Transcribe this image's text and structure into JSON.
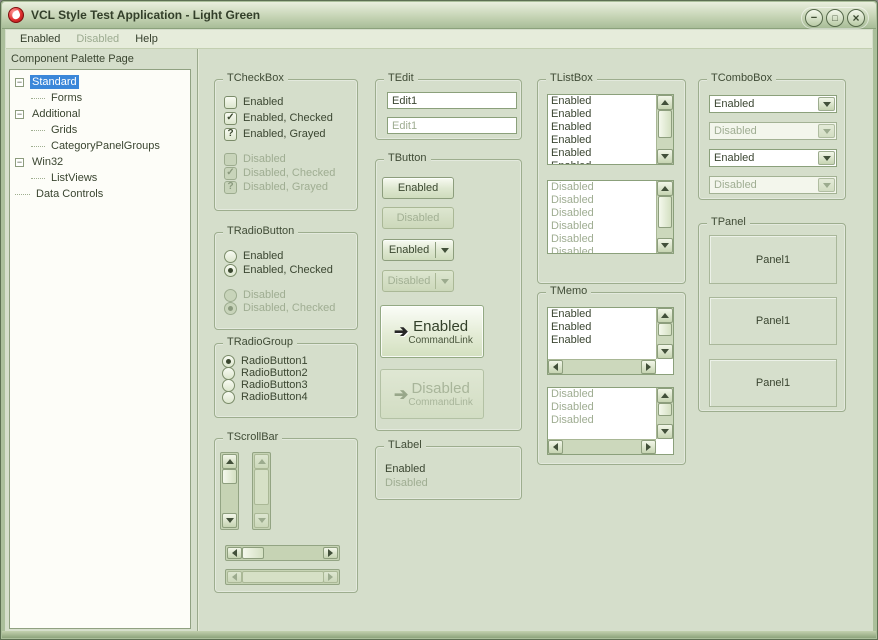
{
  "window": {
    "title": "VCL Style Test Application - Light Green",
    "buttons": {
      "minimize": "−",
      "maximize": "□",
      "close": "×"
    }
  },
  "icons": {
    "tree_collapse": "−",
    "check": "✓",
    "grayed": "?",
    "command_arrow": "➔"
  },
  "menu": {
    "items": [
      {
        "label": "Enabled"
      },
      {
        "label": "Disabled"
      },
      {
        "label": "Help"
      }
    ]
  },
  "palette": {
    "header": "Component Palette Page",
    "tree": [
      {
        "label": "Standard"
      },
      {
        "label": "Forms"
      },
      {
        "label": "Additional"
      },
      {
        "label": "Grids"
      },
      {
        "label": "CategoryPanelGroups"
      },
      {
        "label": "Win32"
      },
      {
        "label": "ListViews"
      },
      {
        "label": "Data Controls"
      }
    ]
  },
  "groups": {
    "checkbox": {
      "title": "TCheckBox",
      "items": [
        {
          "label": "Enabled"
        },
        {
          "label": "Enabled, Checked"
        },
        {
          "label": "Enabled, Grayed"
        },
        {
          "label": "Disabled"
        },
        {
          "label": "Disabled, Checked"
        },
        {
          "label": "Disabled, Grayed"
        }
      ]
    },
    "radiobutton": {
      "title": "TRadioButton",
      "items": [
        {
          "label": "Enabled"
        },
        {
          "label": "Enabled, Checked"
        },
        {
          "label": "Disabled"
        },
        {
          "label": "Disabled, Checked"
        }
      ]
    },
    "radiogroup": {
      "title": "TRadioGroup",
      "items": [
        {
          "label": "RadioButton1"
        },
        {
          "label": "RadioButton2"
        },
        {
          "label": "RadioButton3"
        },
        {
          "label": "RadioButton4"
        }
      ]
    },
    "scrollbar": {
      "title": "TScrollBar"
    },
    "edit": {
      "title": "TEdit",
      "enabled_value": "Edit1",
      "disabled_value": "Edit1"
    },
    "button": {
      "title": "TButton",
      "enabled_label": "Enabled",
      "disabled_label": "Disabled",
      "commandlink_sub": "CommandLink"
    },
    "label": {
      "title": "TLabel",
      "enabled_label": "Enabled",
      "disabled_label": "Disabled"
    },
    "listbox": {
      "title": "TListBox",
      "enabled_item": "Enabled",
      "disabled_item": "Disabled"
    },
    "memo": {
      "title": "TMemo",
      "enabled_item": "Enabled",
      "disabled_item": "Disabled"
    },
    "combobox": {
      "title": "TComboBox",
      "items": [
        {
          "value": "Enabled"
        },
        {
          "value": "Disabled"
        },
        {
          "value": "Enabled"
        },
        {
          "value": "Disabled"
        }
      ]
    },
    "panel": {
      "title": "TPanel",
      "caption": "Panel1"
    }
  },
  "colors": {
    "titlebar_top": "#e9efdd",
    "titlebar_bottom": "#a8bd98",
    "background": "#d5decb",
    "selection_blue": "#3b87d9",
    "enabled_text": "#3a4530",
    "disabled_text": "#9fad92"
  }
}
